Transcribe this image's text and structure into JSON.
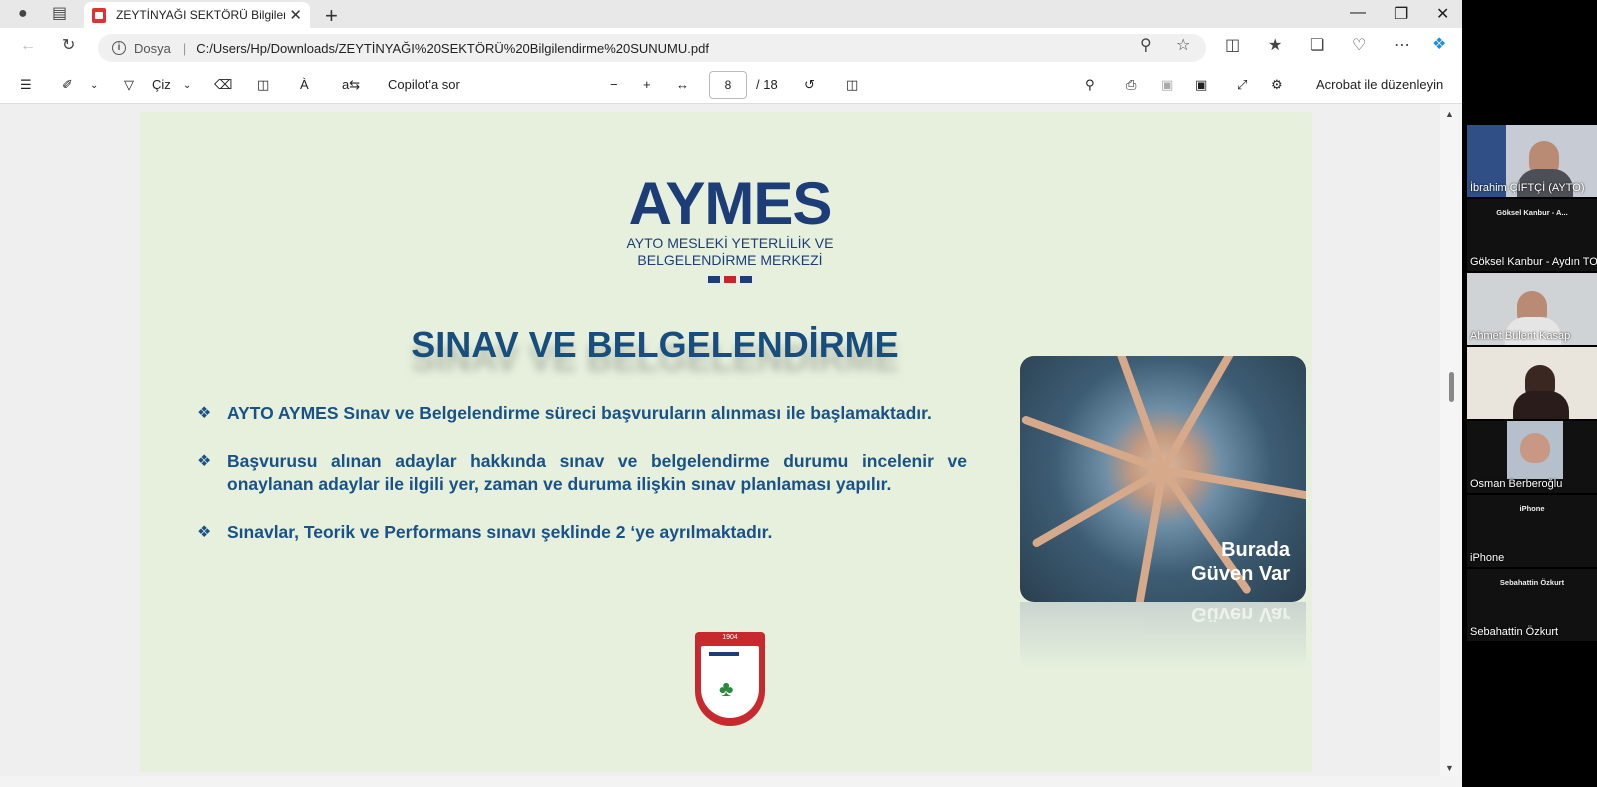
{
  "browser": {
    "tab_title": "ZEYTİNYAĞI SEKTÖRÜ Bilgilendirme",
    "address": {
      "site_label": "Dosya",
      "url": "C:/Users/Hp/Downloads/ZEYTİNYAĞI%20SEKTÖRÜ%20Bilgilendirme%20SUNUMU.pdf"
    }
  },
  "pdf_toolbar": {
    "draw_label": "Çiz",
    "copilot_label": "Copilot'a sor",
    "current_page": "8",
    "page_total": "/ 18",
    "acrobat_label": "Acrobat ile düzenleyin"
  },
  "slide": {
    "logo_text": "AYMES",
    "logo_sub1": "AYTO MESLEKİ YETERLİLİK VE",
    "logo_sub2": "BELGELENDİRME MERKEZİ",
    "heading": "SINAV VE BELGELENDİRME",
    "bullets": [
      "AYTO AYMES Sınav ve Belgelendirme süreci başvuruların alınması ile başlamaktadır.",
      "Başvurusu alınan adaylar hakkında sınav ve belgelendirme durumu incelenir ve onaylanan adaylar ile ilgili yer, zaman ve duruma ilişkin sınav planlaması yapılır.",
      "Sınavlar, Teorik ve Performans sınavı şeklinde 2 ‘ye ayrılmaktadır."
    ],
    "photo_caption_1": "Burada",
    "photo_caption_2": "Güven Var",
    "emblem_year": "1904"
  },
  "participants": [
    {
      "name": "İbrahim ÇİFTÇİ (AYTO)",
      "label": ""
    },
    {
      "name": "Göksel Kanbur - Aydın TO",
      "label": "Göksel Kanbur - A..."
    },
    {
      "name": "Ahmet Bülent Kasap",
      "label": ""
    },
    {
      "name": "",
      "label": ""
    },
    {
      "name": "Osman Berberoğlu",
      "label": ""
    },
    {
      "name": "iPhone",
      "label": "iPhone"
    },
    {
      "name": "Sebahattin Özkurt",
      "label": "Sebahattin Özkurt"
    }
  ]
}
